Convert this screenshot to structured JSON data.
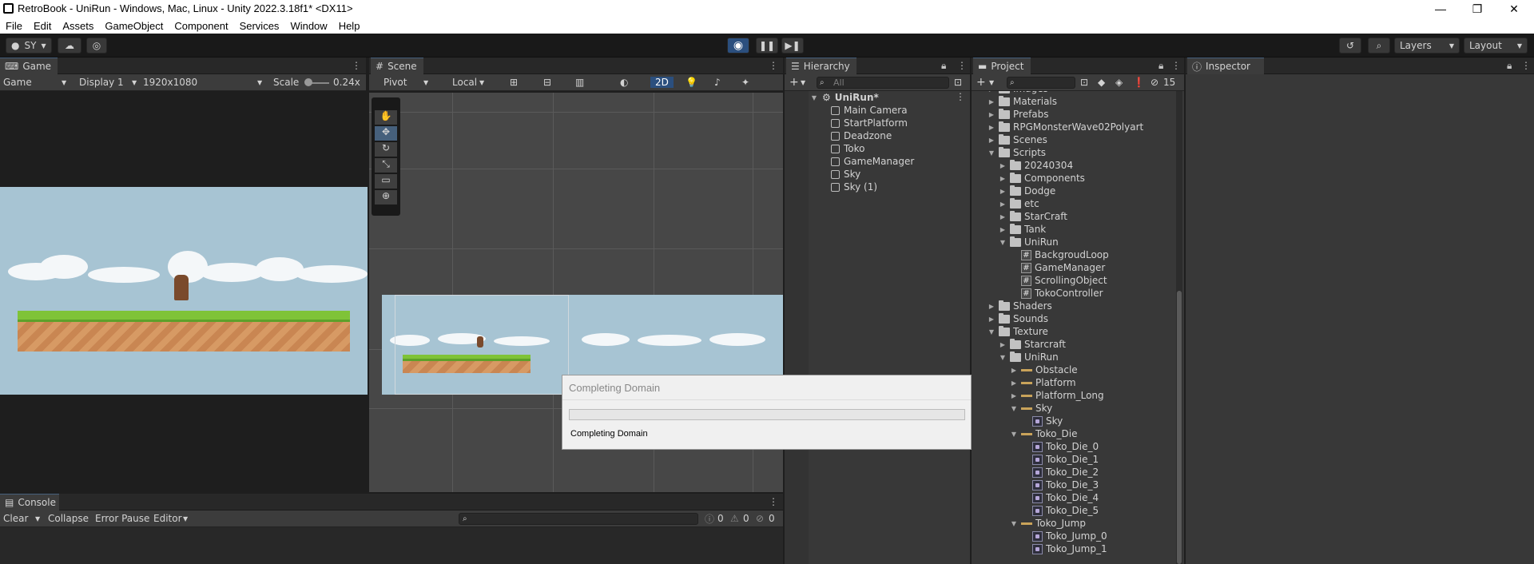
{
  "window": {
    "title": "RetroBook - UniRun - Windows, Mac, Linux - Unity 2022.3.18f1* <DX11>",
    "controls": [
      "—",
      "❐",
      "✕"
    ]
  },
  "menu": [
    "File",
    "Edit",
    "Assets",
    "GameObject",
    "Component",
    "Services",
    "Window",
    "Help"
  ],
  "toolbar": {
    "account": "SY",
    "layers": "Layers",
    "layout": "Layout"
  },
  "game": {
    "tab": "Game",
    "mode": "Game",
    "display": "Display 1",
    "resolution": "1920x1080",
    "scale_label": "Scale",
    "scale_value": "0.24x"
  },
  "scene": {
    "tab": "Scene",
    "pivot": "Pivot",
    "local": "Local",
    "mode2d": "2D"
  },
  "console": {
    "tab": "Console",
    "clear": "Clear",
    "collapse": "Collapse",
    "error_pause": "Error Pause",
    "editor": "Editor",
    "count_log": "0",
    "count_warn": "0",
    "count_error": "0"
  },
  "hierarchy": {
    "tab": "Hierarchy",
    "search_placeholder": "All",
    "root": "UniRun*",
    "items": [
      "Main Camera",
      "StartPlatform",
      "Deadzone",
      "Toko",
      "GameManager",
      "Sky",
      "Sky (1)"
    ]
  },
  "project": {
    "tab": "Project",
    "hidden_count": "15",
    "rows": [
      {
        "label": "Images",
        "indent": 0,
        "kind": "folder",
        "open": false
      },
      {
        "label": "Materials",
        "indent": 0,
        "kind": "folder",
        "open": false
      },
      {
        "label": "Prefabs",
        "indent": 0,
        "kind": "folder",
        "open": false
      },
      {
        "label": "RPGMonsterWave02Polyart",
        "indent": 0,
        "kind": "folder",
        "open": false
      },
      {
        "label": "Scenes",
        "indent": 0,
        "kind": "folder",
        "open": false
      },
      {
        "label": "Scripts",
        "indent": 0,
        "kind": "folder",
        "open": true
      },
      {
        "label": "20240304",
        "indent": 1,
        "kind": "folder",
        "open": false
      },
      {
        "label": "Components",
        "indent": 1,
        "kind": "folder",
        "open": false
      },
      {
        "label": "Dodge",
        "indent": 1,
        "kind": "folder",
        "open": false
      },
      {
        "label": "etc",
        "indent": 1,
        "kind": "folder",
        "open": false
      },
      {
        "label": "StarCraft",
        "indent": 1,
        "kind": "folder",
        "open": false
      },
      {
        "label": "Tank",
        "indent": 1,
        "kind": "folder",
        "open": false
      },
      {
        "label": "UniRun",
        "indent": 1,
        "kind": "folder",
        "open": true
      },
      {
        "label": "BackgroudLoop",
        "indent": 2,
        "kind": "script"
      },
      {
        "label": "GameManager",
        "indent": 2,
        "kind": "script"
      },
      {
        "label": "ScrollingObject",
        "indent": 2,
        "kind": "script"
      },
      {
        "label": "TokoController",
        "indent": 2,
        "kind": "script"
      },
      {
        "label": "Shaders",
        "indent": 0,
        "kind": "folder",
        "open": false
      },
      {
        "label": "Sounds",
        "indent": 0,
        "kind": "folder",
        "open": false
      },
      {
        "label": "Texture",
        "indent": 0,
        "kind": "folder",
        "open": true
      },
      {
        "label": "Starcraft",
        "indent": 1,
        "kind": "folder",
        "open": false
      },
      {
        "label": "UniRun",
        "indent": 1,
        "kind": "folder",
        "open": true
      },
      {
        "label": "Obstacle",
        "indent": 2,
        "kind": "texture",
        "open": false
      },
      {
        "label": "Platform",
        "indent": 2,
        "kind": "texture",
        "open": false
      },
      {
        "label": "Platform_Long",
        "indent": 2,
        "kind": "texture",
        "open": false
      },
      {
        "label": "Sky",
        "indent": 2,
        "kind": "texture",
        "open": true
      },
      {
        "label": "Sky",
        "indent": 3,
        "kind": "sprite"
      },
      {
        "label": "Toko_Die",
        "indent": 2,
        "kind": "texture",
        "open": true
      },
      {
        "label": "Toko_Die_0",
        "indent": 3,
        "kind": "sprite"
      },
      {
        "label": "Toko_Die_1",
        "indent": 3,
        "kind": "sprite"
      },
      {
        "label": "Toko_Die_2",
        "indent": 3,
        "kind": "sprite"
      },
      {
        "label": "Toko_Die_3",
        "indent": 3,
        "kind": "sprite"
      },
      {
        "label": "Toko_Die_4",
        "indent": 3,
        "kind": "sprite"
      },
      {
        "label": "Toko_Die_5",
        "indent": 3,
        "kind": "sprite"
      },
      {
        "label": "Toko_Jump",
        "indent": 2,
        "kind": "texture",
        "open": true
      },
      {
        "label": "Toko_Jump_0",
        "indent": 3,
        "kind": "sprite"
      },
      {
        "label": "Toko_Jump_1",
        "indent": 3,
        "kind": "sprite"
      }
    ]
  },
  "inspector": {
    "tab": "Inspector"
  },
  "dialog": {
    "title": "Completing Domain",
    "message": "Completing Domain"
  },
  "colors": {
    "accent": "#46607c",
    "play_blue": "#3a79d8",
    "sky": "#a7c4d3",
    "grass": "#7fc338",
    "dirt": "#d79a64"
  }
}
